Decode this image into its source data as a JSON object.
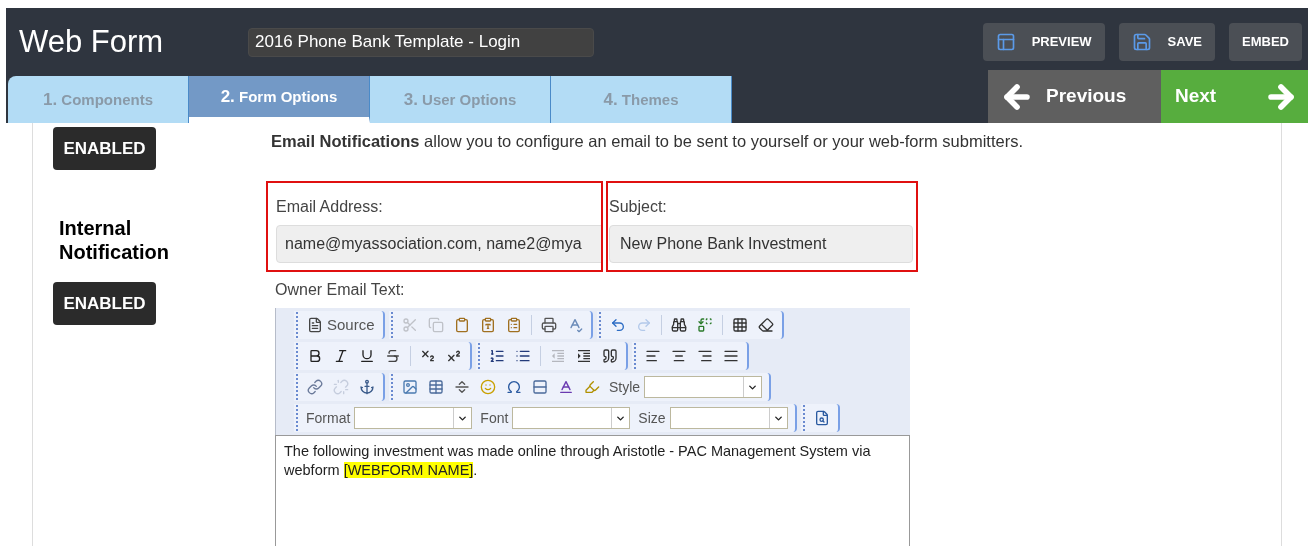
{
  "window": {
    "title": "Web Form"
  },
  "form_name": {
    "value": "2016 Phone Bank Template - Login"
  },
  "header_buttons": [
    {
      "kind": "preview",
      "label": "PREVIEW"
    },
    {
      "kind": "save",
      "label": "SAVE"
    },
    {
      "kind": "embed",
      "label": "EMBED"
    }
  ],
  "tabs": [
    {
      "number": "1.",
      "label": "Components",
      "selected": false
    },
    {
      "number": "2.",
      "label": "Form Options",
      "selected": true
    },
    {
      "number": "3.",
      "label": "User Options",
      "selected": false
    },
    {
      "number": "4.",
      "label": "Themes",
      "selected": false
    }
  ],
  "nav": {
    "previous": "Previous",
    "next": "Next"
  },
  "top_section": {
    "status": "ENABLED",
    "description": "**Email Notifications** allow you to configure an email to be sent to yourself or your web-form submitters."
  },
  "internal_notification": {
    "title": "Internal Notification",
    "status": "ENABLED",
    "email_address": {
      "label": "Email Address:",
      "value": "name@myassociation.com, name2@mya"
    },
    "subject": {
      "label": "Subject:",
      "value": "New Phone Bank Investment"
    },
    "owner_email_text": {
      "label": "Owner Email Text:",
      "toolbar": [
        [
          [
            {
              "kind": "source",
              "label": "Source",
              "disabled": false
            }
          ],
          [
            {
              "kind": "cut",
              "disabled": true
            },
            {
              "kind": "copy",
              "disabled": true
            },
            {
              "kind": "paste",
              "disabled": false
            },
            {
              "kind": "paste-text",
              "disabled": false
            },
            {
              "kind": "paste-word",
              "disabled": false
            },
            {
              "kind": "separator"
            },
            {
              "kind": "print",
              "disabled": false
            },
            {
              "kind": "spellcheck",
              "disabled": false
            }
          ],
          [
            {
              "kind": "undo",
              "disabled": false
            },
            {
              "kind": "redo",
              "disabled": true
            },
            {
              "kind": "separator"
            },
            {
              "kind": "find",
              "disabled": false
            },
            {
              "kind": "replace",
              "disabled": false
            },
            {
              "kind": "separator"
            },
            {
              "kind": "select-all",
              "disabled": false
            },
            {
              "kind": "remove-format",
              "disabled": false
            }
          ]
        ],
        [
          [
            {
              "kind": "bold",
              "disabled": false
            },
            {
              "kind": "italic",
              "disabled": false
            },
            {
              "kind": "underline",
              "disabled": false
            },
            {
              "kind": "strike",
              "disabled": false
            },
            {
              "kind": "separator"
            },
            {
              "kind": "subscript",
              "disabled": false
            },
            {
              "kind": "superscript",
              "disabled": false
            }
          ],
          [
            {
              "kind": "ordered-list",
              "disabled": false
            },
            {
              "kind": "bullet-list",
              "disabled": false
            },
            {
              "kind": "separator"
            },
            {
              "kind": "outdent",
              "disabled": true
            },
            {
              "kind": "indent",
              "disabled": false
            },
            {
              "kind": "blockquote",
              "disabled": false
            }
          ],
          [
            {
              "kind": "align-left",
              "disabled": false
            },
            {
              "kind": "align-center",
              "disabled": false
            },
            {
              "kind": "align-right",
              "disabled": false
            },
            {
              "kind": "align-justify",
              "disabled": false
            }
          ]
        ],
        [
          [
            {
              "kind": "link",
              "disabled": false
            },
            {
              "kind": "unlink",
              "disabled": true
            },
            {
              "kind": "anchor",
              "disabled": false
            }
          ],
          [
            {
              "kind": "image",
              "disabled": false
            },
            {
              "kind": "table",
              "disabled": false
            },
            {
              "kind": "horizontal-rule",
              "disabled": false
            },
            {
              "kind": "smiley",
              "disabled": false
            },
            {
              "kind": "special-char",
              "disabled": false
            },
            {
              "kind": "page-break",
              "disabled": false
            },
            {
              "kind": "text-color",
              "disabled": false
            },
            {
              "kind": "background-color",
              "disabled": false
            },
            {
              "kind": "combo",
              "label": "Style",
              "disabled": false
            }
          ]
        ],
        [
          [
            {
              "kind": "combo",
              "label": "Format",
              "disabled": false
            },
            {
              "kind": "combo",
              "label": "Font",
              "disabled": false
            },
            {
              "kind": "combo",
              "label": "Size",
              "disabled": false
            }
          ],
          [
            {
              "kind": "preview",
              "disabled": false
            }
          ]
        ]
      ],
      "body": [
        {
          "text": "The following investment was made online through Aristotle - PAC Management System via webform ",
          "highlighted": false
        },
        {
          "text": "[WEBFORM NAME]",
          "highlighted": true
        },
        {
          "text": ".",
          "highlighted": false
        }
      ]
    }
  }
}
